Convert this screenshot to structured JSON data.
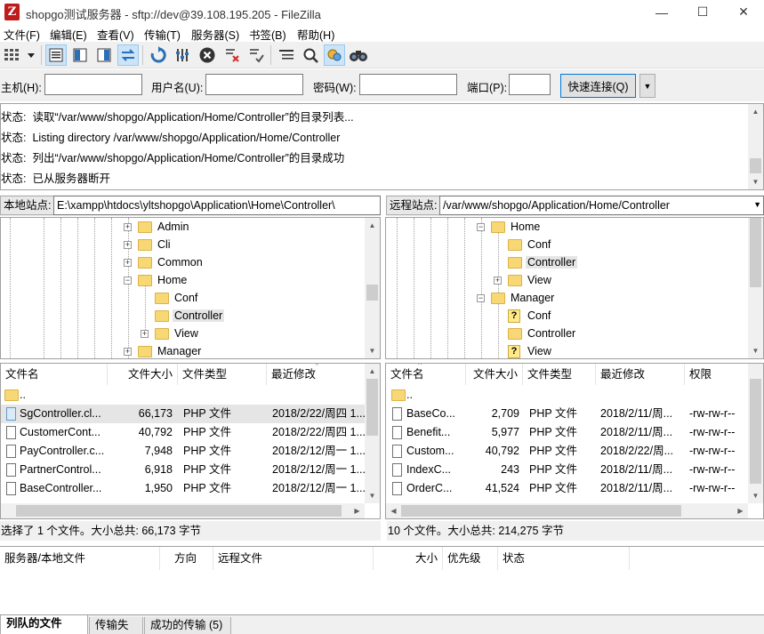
{
  "window": {
    "title": "shopgo测试服务器 - sftp://dev@39.108.195.205 - FileZilla",
    "app_icon": "Z",
    "minimize": "—",
    "maximize": "☐",
    "close": "✕"
  },
  "menu": [
    "文件(F)",
    "编辑(E)",
    "查看(V)",
    "传输(T)",
    "服务器(S)",
    "书签(B)",
    "帮助(H)"
  ],
  "quickconnect": {
    "host_label": "主机(H):",
    "host_value": "",
    "user_label": "用户名(U):",
    "user_value": "",
    "pass_label": "密码(W):",
    "pass_value": "",
    "port_label": "端口(P):",
    "port_value": "",
    "button": "快速连接(Q)"
  },
  "log": [
    {
      "label": "状态:",
      "text": "读取“/var/www/shopgo/Application/Home/Controller”的目录列表..."
    },
    {
      "label": "状态:",
      "text": "Listing directory /var/www/shopgo/Application/Home/Controller"
    },
    {
      "label": "状态:",
      "text": "列出“/var/www/shopgo/Application/Home/Controller”的目录成功"
    },
    {
      "label": "状态:",
      "text": "已从服务器断开"
    }
  ],
  "local": {
    "site_label": "本地站点:",
    "path": "E:\\xampp\\htdocs\\yltshopgo\\Application\\Home\\Controller\\",
    "tree": [
      {
        "name": "Admin",
        "exp": "+"
      },
      {
        "name": "Cli",
        "exp": "+"
      },
      {
        "name": "Common",
        "exp": "+"
      },
      {
        "name": "Home",
        "exp": "−"
      },
      {
        "name": "Conf",
        "exp": ""
      },
      {
        "name": "Controller",
        "exp": ""
      },
      {
        "name": "View",
        "exp": "+"
      },
      {
        "name": "Manager",
        "exp": "+"
      }
    ],
    "headers": [
      "文件名",
      "文件大小",
      "文件类型",
      "最近修改"
    ],
    "files": [
      {
        "name": "..",
        "size": "",
        "type": "",
        "modified": ""
      },
      {
        "name": "SgController.cl...",
        "size": "66,173",
        "type": "PHP 文件",
        "modified": "2018/2/22/周四 1..."
      },
      {
        "name": "CustomerCont...",
        "size": "40,792",
        "type": "PHP 文件",
        "modified": "2018/2/22/周四 1..."
      },
      {
        "name": "PayController.c...",
        "size": "7,948",
        "type": "PHP 文件",
        "modified": "2018/2/12/周一 1..."
      },
      {
        "name": "PartnerControl...",
        "size": "6,918",
        "type": "PHP 文件",
        "modified": "2018/2/12/周一 1..."
      },
      {
        "name": "BaseController...",
        "size": "1,950",
        "type": "PHP 文件",
        "modified": "2018/2/12/周一 1..."
      }
    ],
    "status": "选择了 1 个文件。大小总共: 66,173 字节"
  },
  "remote": {
    "site_label": "远程站点:",
    "path": "/var/www/shopgo/Application/Home/Controller",
    "tree": [
      {
        "name": "Home",
        "exp": "−",
        "q": false
      },
      {
        "name": "Conf",
        "exp": "",
        "q": false
      },
      {
        "name": "Controller",
        "exp": "",
        "q": false
      },
      {
        "name": "View",
        "exp": "+",
        "q": false
      },
      {
        "name": "Manager",
        "exp": "−",
        "q": false
      },
      {
        "name": "Conf",
        "exp": "",
        "q": true
      },
      {
        "name": "Controller",
        "exp": "",
        "q": false
      },
      {
        "name": "View",
        "exp": "",
        "q": true
      }
    ],
    "headers": [
      "文件名",
      "文件大小",
      "文件类型",
      "最近修改",
      "权限"
    ],
    "files": [
      {
        "name": "..",
        "size": "",
        "type": "",
        "modified": "",
        "perm": ""
      },
      {
        "name": "BaseCo...",
        "size": "2,709",
        "type": "PHP 文件",
        "modified": "2018/2/11/周...",
        "perm": "-rw-rw-r--"
      },
      {
        "name": "Benefit...",
        "size": "5,977",
        "type": "PHP 文件",
        "modified": "2018/2/11/周...",
        "perm": "-rw-rw-r--"
      },
      {
        "name": "Custom...",
        "size": "40,792",
        "type": "PHP 文件",
        "modified": "2018/2/22/周...",
        "perm": "-rw-rw-r--"
      },
      {
        "name": "IndexC...",
        "size": "243",
        "type": "PHP 文件",
        "modified": "2018/2/11/周...",
        "perm": "-rw-rw-r--"
      },
      {
        "name": "OrderC...",
        "size": "41,524",
        "type": "PHP 文件",
        "modified": "2018/2/11/周...",
        "perm": "-rw-rw-r--"
      }
    ],
    "status": "10 个文件。大小总共: 214,275 字节"
  },
  "queue": {
    "headers": [
      "服务器/本地文件",
      "方向",
      "远程文件",
      "大小",
      "优先级",
      "状态"
    ]
  },
  "tabs": [
    "列队的文件",
    "传输失败",
    "成功的传输 (5)"
  ],
  "colors": {
    "accent": "#0078d7",
    "folder": "#f8d775",
    "selection": "#e5e5e5"
  }
}
